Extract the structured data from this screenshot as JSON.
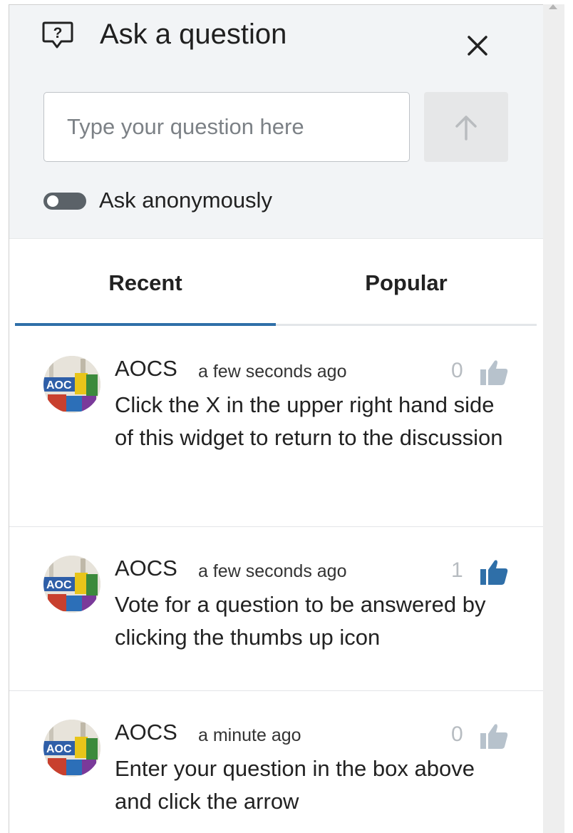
{
  "header": {
    "title": "Ask a question",
    "input_placeholder": "Type your question here",
    "input_value": "",
    "anonymous_label": "Ask anonymously",
    "anonymous_enabled": false
  },
  "tabs": [
    {
      "label": "Recent",
      "active": true
    },
    {
      "label": "Popular",
      "active": false
    }
  ],
  "questions": [
    {
      "author": "AOCS",
      "time": "a few seconds ago",
      "votes": "0",
      "voted": false,
      "text": "Click the X in the upper right hand side of this widget to return to the discussion"
    },
    {
      "author": "AOCS",
      "time": "a few seconds ago",
      "votes": "1",
      "voted": true,
      "text": "Vote for a question to be answered by clicking the thumbs up icon"
    },
    {
      "author": "AOCS",
      "time": "a minute ago",
      "votes": "0",
      "voted": false,
      "text": "Enter your question in the box above and click the arrow"
    }
  ],
  "icons": {
    "question": "question-bubble-icon",
    "close": "close-icon",
    "send": "arrow-up-icon",
    "vote": "thumbs-up-icon"
  },
  "colors": {
    "accent": "#2f6fa8",
    "voted_thumb": "#2f6fa8",
    "unvoted_thumb": "#b7c2cc",
    "header_bg": "#f2f4f6",
    "toggle_off": "#5b6268"
  }
}
